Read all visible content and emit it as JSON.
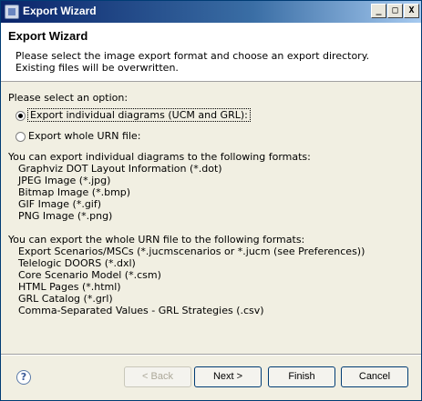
{
  "window": {
    "title": "Export Wizard",
    "controls": {
      "minimize": "_",
      "maximize": "□",
      "close": "X"
    }
  },
  "header": {
    "title": "Export Wizard",
    "description": [
      "Please select the image export format and choose an export directory.",
      "Existing files will be overwritten."
    ]
  },
  "options": {
    "prompt": "Please select an option:",
    "radio_individual": {
      "label": "Export individual diagrams (UCM and GRL):",
      "checked": true
    },
    "radio_whole": {
      "label": "Export whole URN file:",
      "checked": false
    }
  },
  "individual_formats": {
    "intro": "You can export individual diagrams to the following formats:",
    "items": [
      "Graphviz DOT Layout Information (*.dot)",
      "JPEG Image (*.jpg)",
      "Bitmap Image (*.bmp)",
      "GIF Image (*.gif)",
      "PNG Image (*.png)"
    ]
  },
  "urn_formats": {
    "intro": "You can export the whole URN file to the following formats:",
    "items": [
      "Export Scenarios/MSCs (*.jucmscenarios or *.jucm (see Preferences))",
      "Telelogic DOORS (*.dxl)",
      "Core Scenario Model (*.csm)",
      "HTML Pages (*.html)",
      "GRL Catalog (*.grl)",
      "Comma-Separated Values - GRL Strategies (.csv)"
    ]
  },
  "buttons": {
    "help": "?",
    "back": "< Back",
    "next": "Next >",
    "finish": "Finish",
    "cancel": "Cancel"
  }
}
